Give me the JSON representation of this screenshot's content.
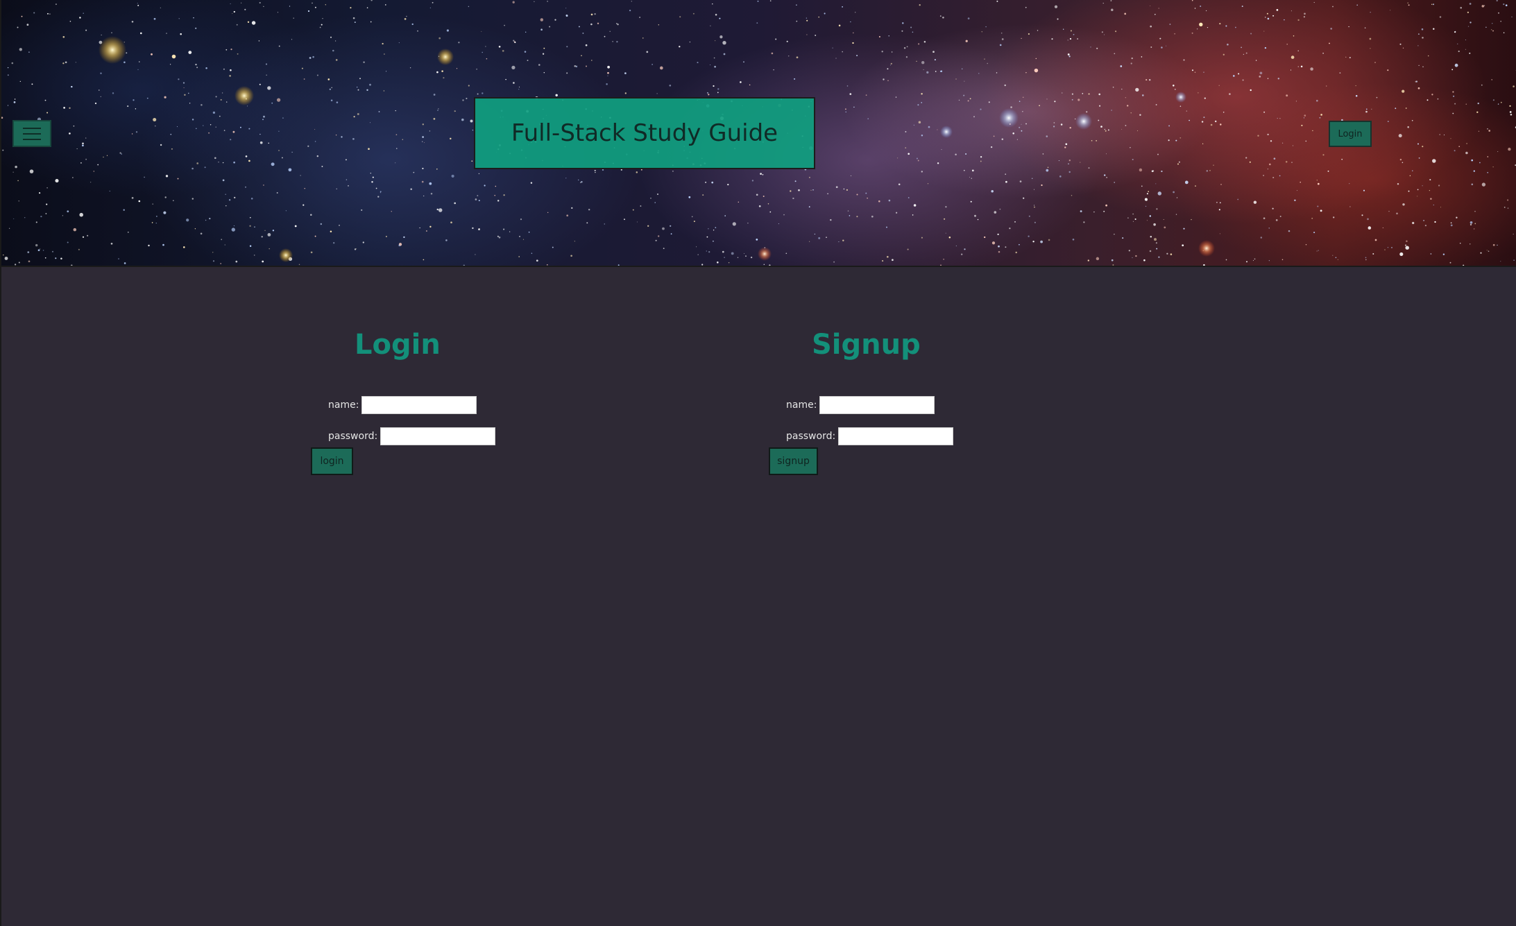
{
  "header": {
    "title": "Full-Stack Study Guide",
    "login_button": "Login",
    "menu_icon": "hamburger-menu-icon"
  },
  "login_form": {
    "heading": "Login",
    "name_label": "name:",
    "name_value": "",
    "password_label": "password:",
    "password_value": "",
    "submit_label": "login"
  },
  "signup_form": {
    "heading": "Signup",
    "name_label": "name:",
    "name_value": "",
    "password_label": "password:",
    "password_value": "",
    "submit_label": "signup"
  },
  "colors": {
    "page_background": "#2e2935",
    "accent": "#13907a",
    "title_box": "#10a080",
    "button": "#1c6b58"
  }
}
